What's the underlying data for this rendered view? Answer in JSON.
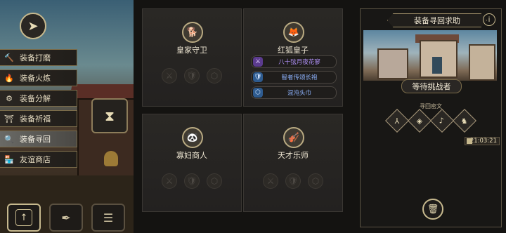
{
  "menu": {
    "items": [
      {
        "icon": "hammer-icon",
        "glyph": "🔨",
        "label": "装备打磨"
      },
      {
        "icon": "flame-icon",
        "glyph": "🔥",
        "label": "装备火炼"
      },
      {
        "icon": "split-icon",
        "glyph": "⚙",
        "label": "装备分解"
      },
      {
        "icon": "pray-icon",
        "glyph": "⛩",
        "label": "装备祈福"
      },
      {
        "icon": "search-icon",
        "glyph": "🔍",
        "label": "装备寻回",
        "active": true
      },
      {
        "icon": "shop-icon",
        "glyph": "🏪",
        "label": "友谊商店"
      }
    ]
  },
  "cards": [
    {
      "name": "皇家守卫",
      "avatar": "dog-knight-avatar",
      "glyph": "🐕",
      "slots": [
        "⚔",
        "🛡",
        "⬡"
      ]
    },
    {
      "name": "红狐皇子",
      "avatar": "fox-prince-avatar",
      "glyph": "🦊",
      "equips": [
        {
          "text": "八十弦月夜花寥",
          "tier": "purple",
          "icon": "sword-icon",
          "glyph": "⚔"
        },
        {
          "text": "智者传颂长袍",
          "tier": "blue",
          "icon": "robe-icon",
          "glyph": "🛡"
        },
        {
          "text": "混沌头巾",
          "tier": "blue",
          "icon": "helm-icon",
          "glyph": "⬡"
        }
      ]
    },
    {
      "name": "寡妇商人",
      "avatar": "widow-merchant-avatar",
      "glyph": "🐼",
      "slots": [
        "⚔",
        "🛡",
        "⬡"
      ]
    },
    {
      "name": "天才乐师",
      "avatar": "musician-avatar",
      "glyph": "🎻",
      "slots": [
        "⚔",
        "🛡",
        "⬡"
      ]
    }
  ],
  "panel": {
    "title": "装备寻回求助",
    "info_glyph": "i",
    "status": "等待挑战者",
    "runes_label": "寻回密文",
    "runes": [
      "⅄",
      "◈",
      "♪",
      "♞"
    ],
    "timer": "21:03:21"
  },
  "colors": {
    "accent": "#c7b98e",
    "purple": "#b494ff",
    "blue": "#8fb4ff"
  }
}
